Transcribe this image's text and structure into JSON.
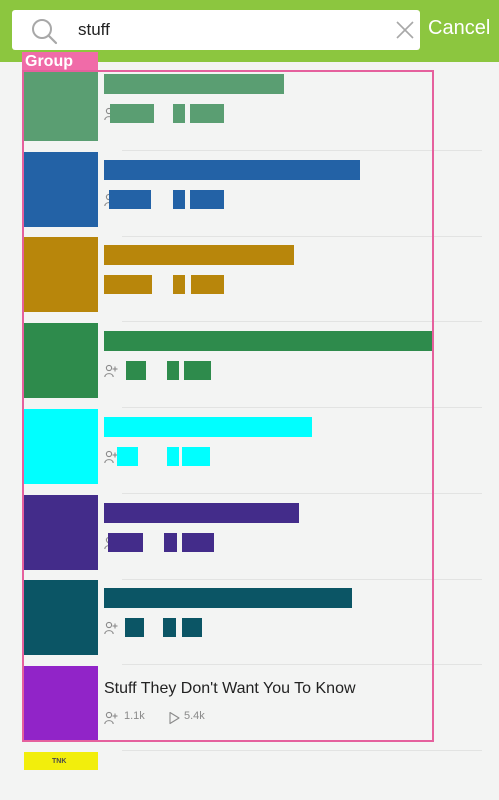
{
  "search": {
    "value": "stuff",
    "cancel_label": "Cancel"
  },
  "group_label": "Group",
  "results": [
    {
      "color": "#5a9e72",
      "redacted": true
    },
    {
      "color": "#2362a6",
      "redacted": true
    },
    {
      "color": "#b8860b",
      "redacted": true
    },
    {
      "color": "#2e8b4c",
      "redacted": true
    },
    {
      "color": "#00ffff",
      "redacted": true
    },
    {
      "color": "#432c8a",
      "redacted": true
    },
    {
      "color": "#0b5565",
      "redacted": true
    },
    {
      "color": "#9124c8",
      "title": "Stuff They Don't Want You To Know",
      "subscribers": "1.1k",
      "plays": "5.4k",
      "icons": [
        "add-user-icon",
        "play-icon"
      ]
    }
  ],
  "partial_next": {
    "thumb_text": "TNK",
    "color": "#f2ee0c"
  }
}
